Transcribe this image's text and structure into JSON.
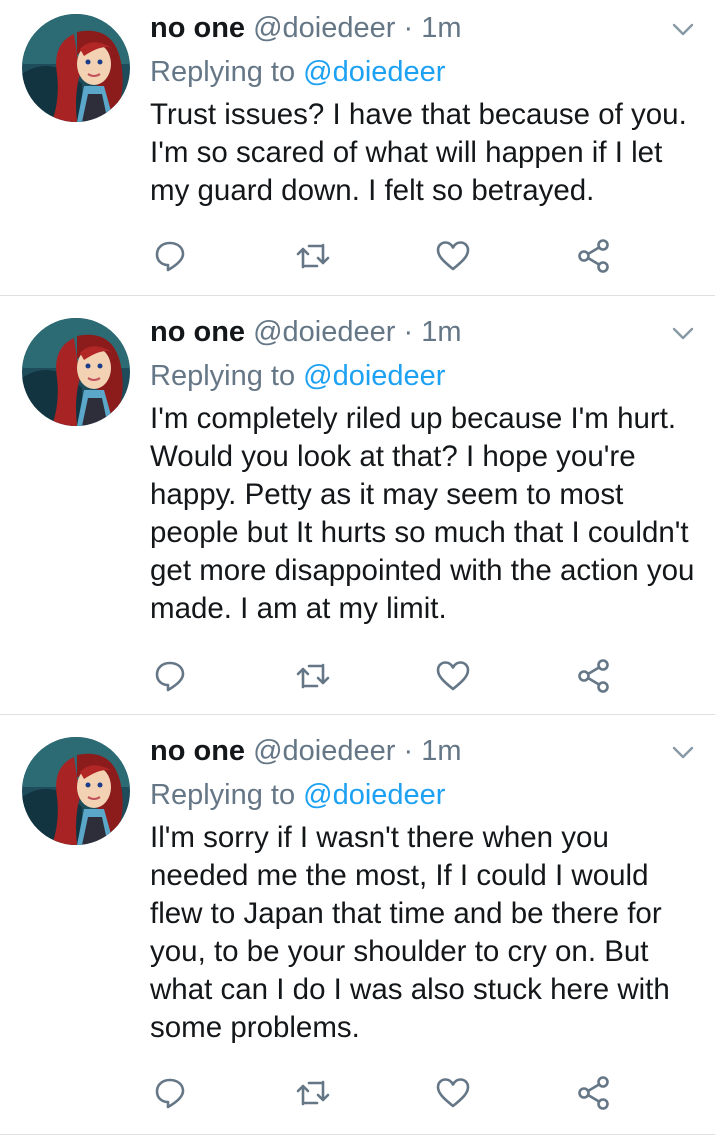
{
  "tweets": [
    {
      "name": "no one",
      "handle": "@doiedeer",
      "separator": "·",
      "time": "1m",
      "replying_prefix": "Replying to",
      "replying_handle": "@doiedeer",
      "text": "Trust issues? I have that because of you. I'm so scared of what will happen if I let my guard down. I felt so betrayed."
    },
    {
      "name": "no one",
      "handle": "@doiedeer",
      "separator": "·",
      "time": "1m",
      "replying_prefix": "Replying to",
      "replying_handle": "@doiedeer",
      "text": "I'm completely riled up because I'm hurt. Would you look at that? I hope you're happy. Petty as it may seem to most people but It hurts so much that I couldn't get more disappointed with the action you made. I am at my limit."
    },
    {
      "name": "no one",
      "handle": "@doiedeer",
      "separator": "·",
      "time": "1m",
      "replying_prefix": "Replying to",
      "replying_handle": "@doiedeer",
      "text": "Il'm sorry if I wasn't there when you needed me the most, If I could I would flew to Japan that time and be there for you, to be your shoulder to cry on. But what can I do I was also stuck here with some problems."
    }
  ],
  "icons": {
    "reply": "reply-icon",
    "retweet": "retweet-icon",
    "like": "heart-icon",
    "share": "share-icon",
    "caret": "chevron-down-icon"
  },
  "colors": {
    "text": "#14171a",
    "secondary": "#657786",
    "link": "#1da1f2",
    "divider": "#dde1e4"
  }
}
